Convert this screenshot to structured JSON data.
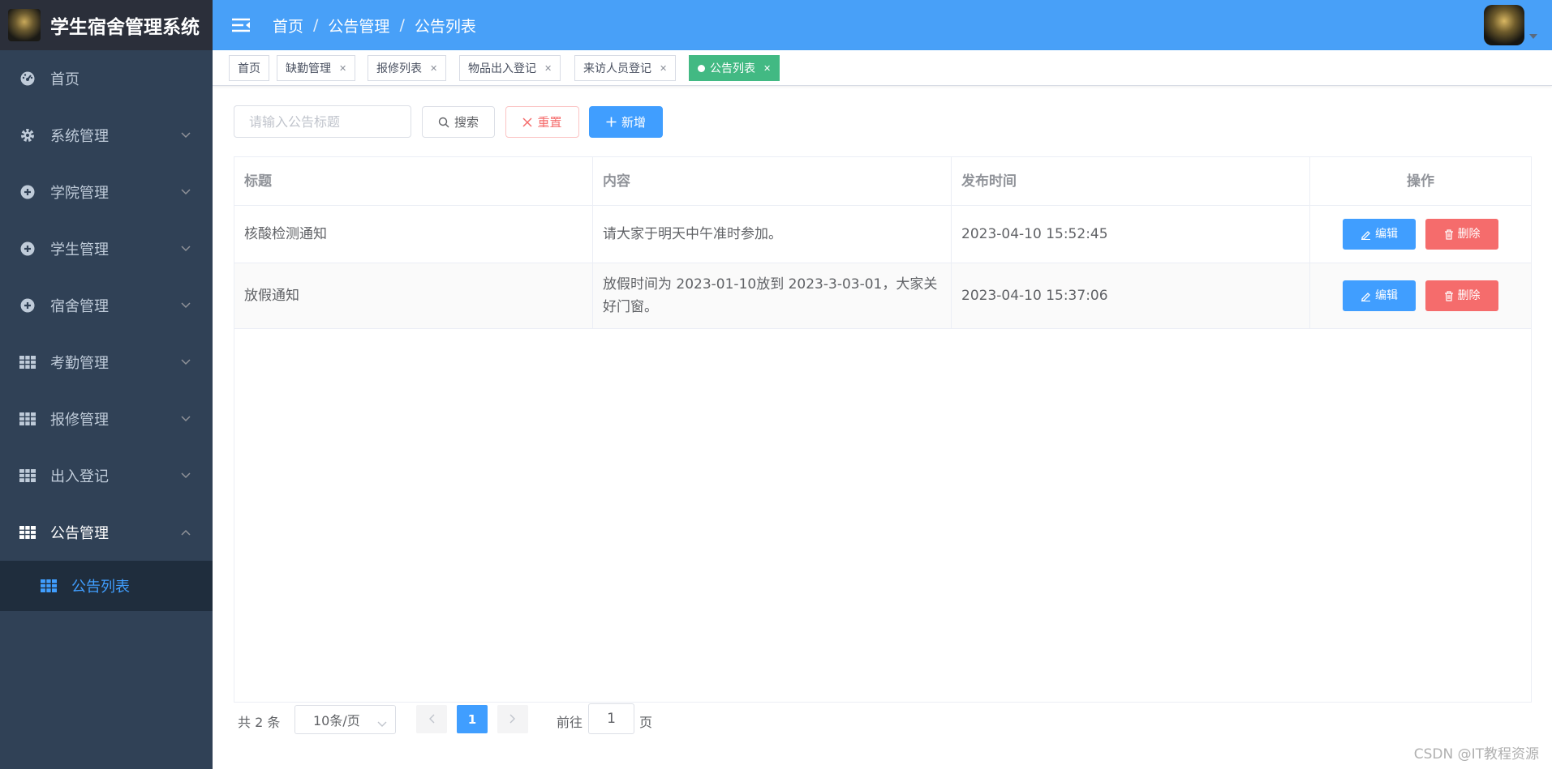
{
  "app": {
    "title": "学生宿舍管理系统"
  },
  "sidebar": {
    "items": [
      {
        "label": "首页",
        "icon": "dashboard-icon"
      },
      {
        "label": "系统管理",
        "icon": "gear-icon"
      },
      {
        "label": "学院管理",
        "icon": "compass-icon"
      },
      {
        "label": "学生管理",
        "icon": "compass-icon"
      },
      {
        "label": "宿舍管理",
        "icon": "compass-icon"
      },
      {
        "label": "考勤管理",
        "icon": "table-icon"
      },
      {
        "label": "报修管理",
        "icon": "table-icon"
      },
      {
        "label": "出入登记",
        "icon": "table-icon"
      },
      {
        "label": "公告管理",
        "icon": "table-icon"
      }
    ],
    "submenu": {
      "label": "公告列表"
    }
  },
  "breadcrumb": [
    "首页",
    "公告管理",
    "公告列表"
  ],
  "tags": [
    {
      "label": "首页"
    },
    {
      "label": "缺勤管理"
    },
    {
      "label": "报修列表"
    },
    {
      "label": "物品出入登记"
    },
    {
      "label": "来访人员登记"
    },
    {
      "label": "公告列表",
      "active": true
    }
  ],
  "toolbar": {
    "search_placeholder": "请输入公告标题",
    "search_label": "搜索",
    "reset_label": "重置",
    "add_label": "新增"
  },
  "table": {
    "columns": [
      "标题",
      "内容",
      "发布时间",
      "操作"
    ],
    "rows": [
      {
        "title": "核酸检测通知",
        "content": "请大家于明天中午准时参加。",
        "time": "2023-04-10 15:52:45"
      },
      {
        "title": "放假通知",
        "content": "放假时间为 2023-01-10放到 2023-3-03-01，大家关好门窗。",
        "time": "2023-04-10 15:37:06"
      }
    ],
    "edit_label": "编辑",
    "delete_label": "删除"
  },
  "pagination": {
    "total_text": "共 2 条",
    "page_size": "10条/页",
    "current_page": "1",
    "goto_label": "前往",
    "goto_value": "1",
    "goto_unit": "页"
  },
  "watermark": "CSDN @IT教程资源",
  "colors": {
    "sidebar": "#304156",
    "navbar": "#48a0f8",
    "primary": "#409eff",
    "danger": "#f56c6c",
    "active_tag": "#42b983"
  }
}
